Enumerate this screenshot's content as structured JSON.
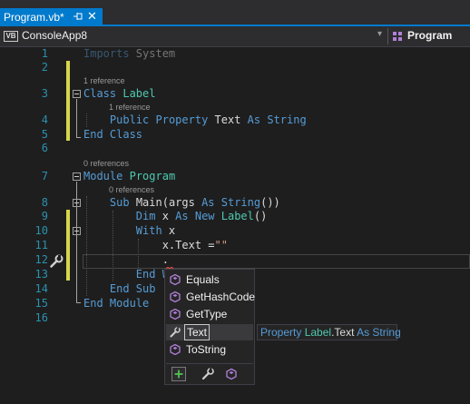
{
  "tab": {
    "title": "Program.vb*",
    "pin": "⊸",
    "close": "✕"
  },
  "navbar": {
    "project": "ConsoleApp8",
    "project_icon": "VB",
    "member": "Program",
    "dropdown_glyph": "▾"
  },
  "gutter": {
    "line_numbers": [
      "1",
      "2",
      "3",
      "4",
      "5",
      "6",
      "7",
      "8",
      "9",
      "10",
      "11",
      "12",
      "13",
      "14",
      "15",
      "16"
    ]
  },
  "code": {
    "line1": {
      "kw": "Imports",
      "rest": " System"
    },
    "lens_label": {
      "ref1": "1 reference",
      "ref2": "1 reference",
      "zero1": "0 references",
      "zero2": "0 references"
    },
    "line3": {
      "kw": "Class",
      "space": " ",
      "name": "Label"
    },
    "line4": {
      "indent": "    ",
      "kw1": "Public",
      "kw2": " Property",
      "name": " Text",
      "kw3": " As",
      "type": " String"
    },
    "line5": {
      "kw": "End Class"
    },
    "line7": {
      "kw": "Module",
      "space": " ",
      "name": "Program"
    },
    "line8": {
      "indent": "    ",
      "kw": "Sub",
      "name": " Main(args",
      "kw2": " As",
      "type": " String",
      "rest": "())"
    },
    "line9": {
      "indent": "        ",
      "kw1": "Dim",
      "mid": " x",
      "kw2": " As",
      "kw3": " New",
      "type": " Label",
      "rest": "()"
    },
    "line10": {
      "indent": "        ",
      "kw": "With",
      "rest": " x"
    },
    "line11": {
      "indent": "            ",
      "rest": "x.Text =",
      "str": "\"\""
    },
    "line12": {
      "indent": "            ",
      "rest": "."
    },
    "line13": {
      "indent": "        ",
      "kw": "End W"
    },
    "line14": {
      "indent": "    ",
      "kw": "End Sub"
    },
    "line15": {
      "kw": "End Module"
    }
  },
  "completion": {
    "items": [
      {
        "label": "Equals",
        "icon": "method-icon"
      },
      {
        "label": "GetHashCode",
        "icon": "method-icon"
      },
      {
        "label": "GetType",
        "icon": "method-icon"
      },
      {
        "label": "Text",
        "icon": "property-wrench-icon",
        "selected": true
      },
      {
        "label": "ToString",
        "icon": "method-icon"
      }
    ],
    "filters": [
      "filter-all-icon",
      "filter-properties-icon",
      "filter-methods-icon"
    ]
  },
  "tooltip": {
    "kw": "Property",
    "type1": " Label",
    "name": ".Text",
    "kw2": " As",
    "type2": " String"
  },
  "colors": {
    "accent": "#007acc",
    "keyword": "#569cd6",
    "type": "#4ec9b0",
    "string": "#d69d85",
    "line_number": "#2b91af",
    "method_icon": "#b180d7",
    "change_marker": "#d6d64a"
  }
}
